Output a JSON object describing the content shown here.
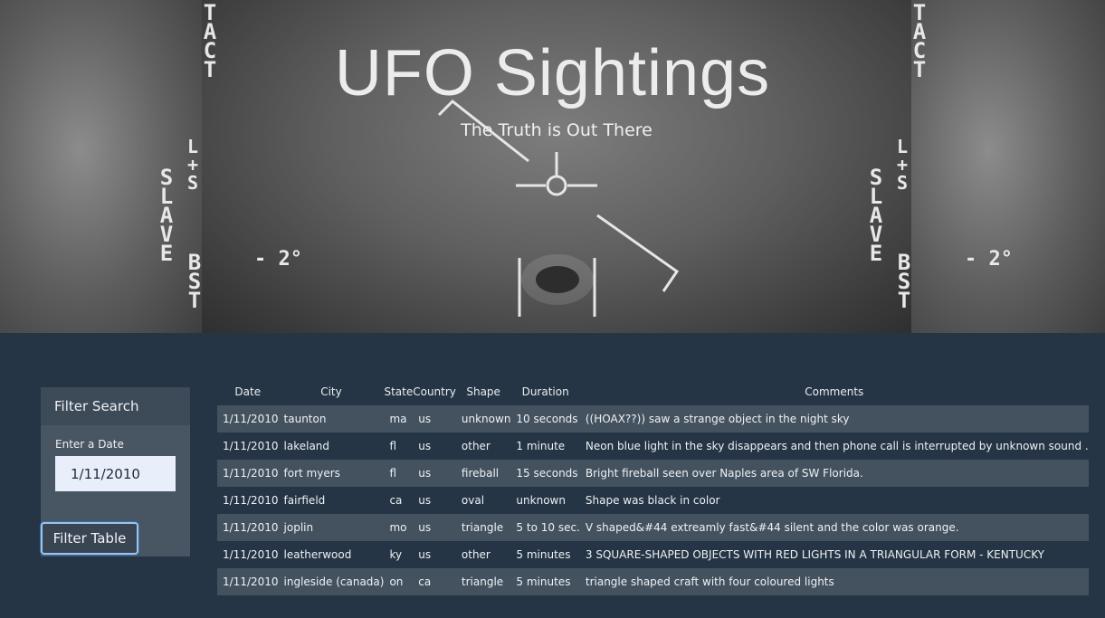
{
  "hero": {
    "title": "UFO Sightings",
    "subtitle": "The Truth is Out There",
    "hud_left_top": "TACT",
    "hud_right_top": "TACT",
    "hud_ls": "L+S",
    "hud_slave": "SLAVE",
    "hud_bst": "BST",
    "hud_deg": "- 2°"
  },
  "filter": {
    "heading": "Filter Search",
    "date_label": "Enter a Date",
    "date_value": "1/11/2010",
    "button_label": "Filter Table"
  },
  "table": {
    "headers": [
      "Date",
      "City",
      "State",
      "Country",
      "Shape",
      "Duration",
      "Comments"
    ],
    "rows": [
      [
        "1/11/2010",
        "taunton",
        "ma",
        "us",
        "unknown",
        "10 seconds",
        "((HOAX??)) saw a strange object in the night sky"
      ],
      [
        "1/11/2010",
        "lakeland",
        "fl",
        "us",
        "other",
        "1 minute",
        "Neon blue light in the sky disappears and then phone call is interrupted by unknown sound ."
      ],
      [
        "1/11/2010",
        "fort myers",
        "fl",
        "us",
        "fireball",
        "15 seconds",
        "Bright fireball seen over Naples area of SW Florida."
      ],
      [
        "1/11/2010",
        "fairfield",
        "ca",
        "us",
        "oval",
        "unknown",
        "Shape was black in color"
      ],
      [
        "1/11/2010",
        "joplin",
        "mo",
        "us",
        "triangle",
        "5 to 10 sec.",
        "V shaped&#44 extreamly fast&#44 silent and the color was orange."
      ],
      [
        "1/11/2010",
        "leatherwood",
        "ky",
        "us",
        "other",
        "5 minutes",
        "3 SQUARE-SHAPED OBJECTS WITH RED LIGHTS IN A TRIANGULAR FORM - KENTUCKY"
      ],
      [
        "1/11/2010",
        "ingleside (canada)",
        "on",
        "ca",
        "triangle",
        "5 minutes",
        "triangle shaped craft with four coloured lights"
      ]
    ]
  }
}
